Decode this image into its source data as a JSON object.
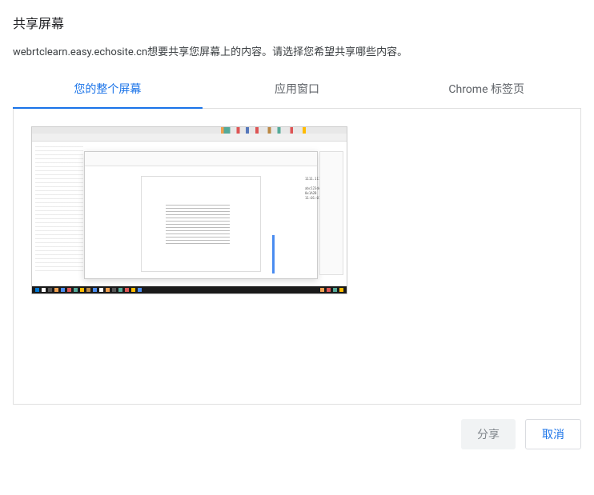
{
  "dialog": {
    "title": "共享屏幕",
    "subtitle": "webrtclearn.easy.echosite.cn想要共享您屏幕上的内容。请选择您希望共享哪些内容。"
  },
  "tabs": [
    {
      "label": "您的整个屏幕",
      "active": true
    },
    {
      "label": "应用窗口",
      "active": false
    },
    {
      "label": "Chrome 标签页",
      "active": false
    }
  ],
  "buttons": {
    "share": "分享",
    "cancel": "取消"
  }
}
